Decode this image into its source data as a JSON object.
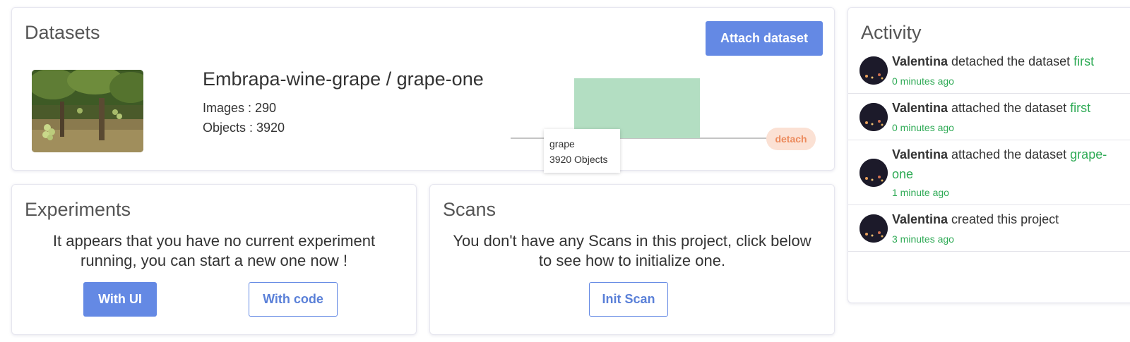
{
  "datasets": {
    "title": "Datasets",
    "attach_label": "Attach dataset",
    "item": {
      "name": "Embrapa-wine-grape / grape-one",
      "images": "Images : 290",
      "objects": "Objects : 3920",
      "detach_label": "detach",
      "tooltip_label": "grape",
      "tooltip_value": "3920 Objects"
    }
  },
  "chart_data": {
    "type": "bar",
    "categories": [
      "grape"
    ],
    "values": [
      3920
    ],
    "title": "",
    "xlabel": "",
    "ylabel": "",
    "ylim": [
      0,
      3920
    ],
    "grid": false,
    "bar_color": "#b3dec2"
  },
  "experiments": {
    "title": "Experiments",
    "message": "It appears that you have no current experiment running, you can start a new one now !",
    "with_ui_label": "With UI",
    "with_code_label": "With code"
  },
  "scans": {
    "title": "Scans",
    "message": "You don't have any Scans in this project, click below to see how to initialize one.",
    "init_label": "Init Scan"
  },
  "activity": {
    "title": "Activity",
    "items": [
      {
        "user": "Valentina",
        "action": " detached the dataset ",
        "target": "first",
        "time": "0 minutes ago"
      },
      {
        "user": "Valentina",
        "action": " attached the dataset ",
        "target": "first",
        "time": "0 minutes ago"
      },
      {
        "user": "Valentina",
        "action": " attached the dataset ",
        "target": "grape-one",
        "time": "1 minute ago"
      },
      {
        "user": "Valentina",
        "action": " created this project",
        "target": "",
        "time": "3 minutes ago"
      }
    ]
  },
  "colors": {
    "primary": "#6489e4",
    "success": "#2eaa55",
    "detach_bg": "#fbe1d4",
    "detach_fg": "#ec8a5c"
  }
}
